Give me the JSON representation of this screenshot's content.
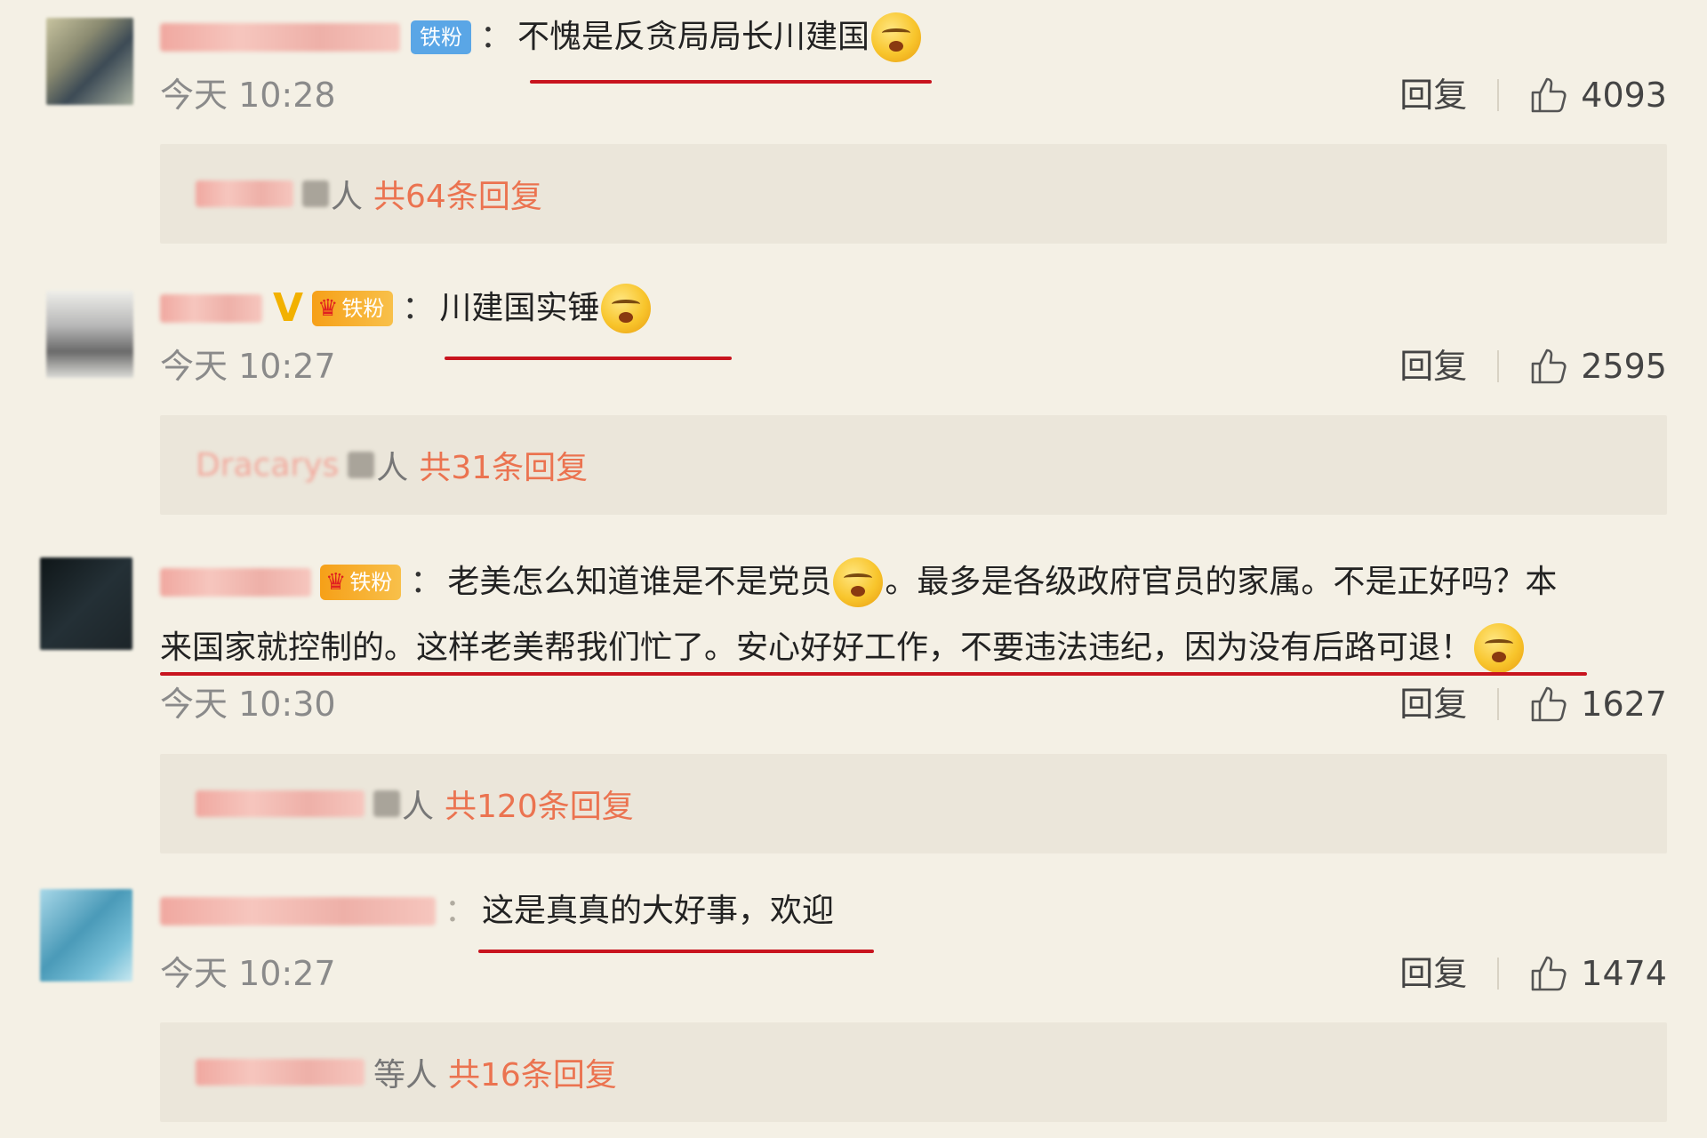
{
  "common": {
    "reply_label": "回复",
    "deng": "等人",
    "ren": "人"
  },
  "comments": [
    {
      "badge": "铁粉",
      "text": "不愧是反贪局局长川建国",
      "time": "今天 10:28",
      "likes": "4093",
      "replies_total": "共64条回复"
    },
    {
      "badge": "铁粉",
      "text": "川建国实锤",
      "time": "今天 10:27",
      "likes": "2595",
      "reply_user": "Dracarys",
      "replies_total": "共31条回复"
    },
    {
      "badge": "铁粉",
      "text_a": "老美怎么知道谁是不是党员",
      "text_b": "。最多是各级政府官员的家属。不是正好吗？本",
      "text_c": "来国家就控制的。这样老美帮我们忙了。安心好好工作，不要违法违纪，因为没有后路可退！",
      "time": "今天 10:30",
      "likes": "1627",
      "replies_total": "共120条回复"
    },
    {
      "text": "这是真真的大好事，欢迎",
      "time": "今天 10:27",
      "likes": "1474",
      "replies_total": "共16条回复"
    }
  ]
}
